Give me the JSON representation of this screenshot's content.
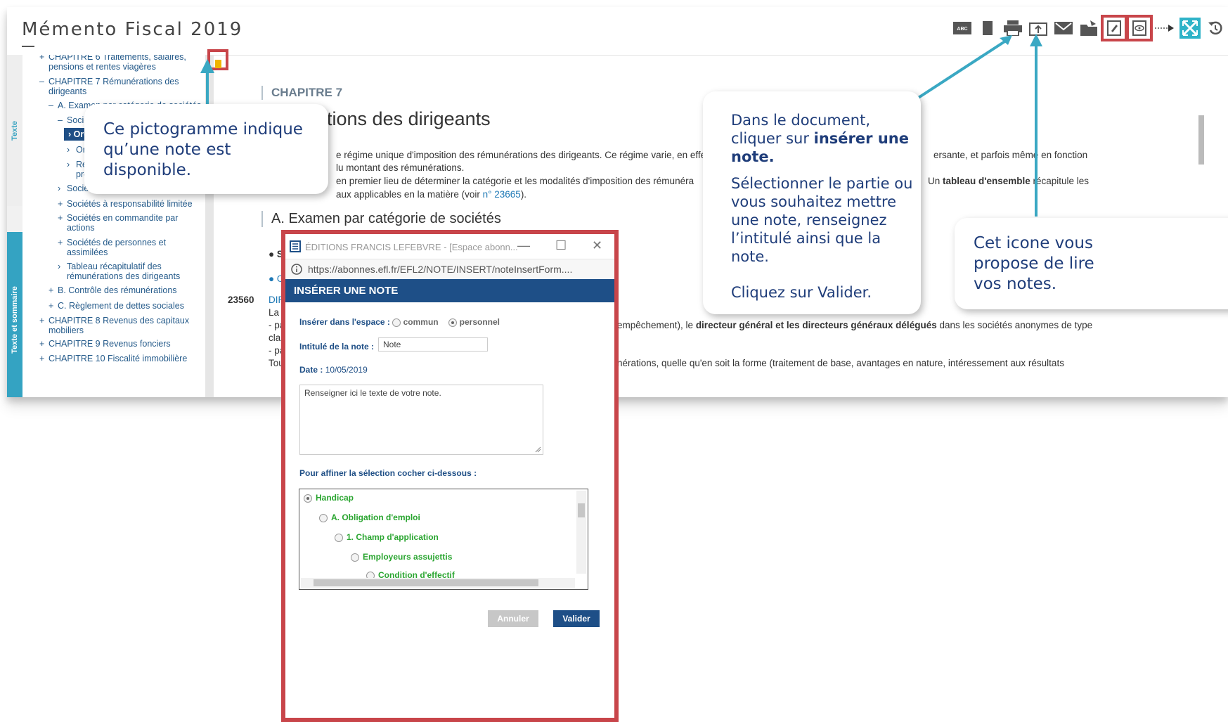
{
  "app": {
    "title": "Mémento Fiscal 2019",
    "toolbar_icons": [
      "abc-icon",
      "bookmark-icon",
      "print-icon",
      "export-icon",
      "mail-icon",
      "folder-icon",
      "insert-note-icon",
      "read-notes-icon",
      "arrow-icon",
      "fullscreen-icon",
      "history-icon"
    ]
  },
  "sidebar": {
    "tab_text": "Texte",
    "tab_summary": "Texte et sommaire",
    "items": [
      {
        "marker": "+",
        "label": "CHAPITRE 6 Traitements, salaires,"
      },
      {
        "marker": "",
        "label": "pensions et rentes viagères"
      },
      {
        "marker": "–",
        "label": "CHAPITRE 7 Rémunérations des"
      },
      {
        "marker": "",
        "label": "dirigeants"
      },
      {
        "marker": "–",
        "label": "A. Examen par catégorie de sociétés"
      },
      {
        "marker": "–",
        "label": "Société"
      },
      {
        "marker": "›",
        "label": "Orga"
      },
      {
        "marker": "›",
        "label": "Orga"
      },
      {
        "marker": "›",
        "label": "Régi"
      },
      {
        "marker": "",
        "label": "prés"
      },
      {
        "marker": "›",
        "label": "Société"
      },
      {
        "marker": "+",
        "label": "Sociétés à responsabilité limitée"
      },
      {
        "marker": "+",
        "label": "Sociétés en commandite par"
      },
      {
        "marker": "",
        "label": "actions"
      },
      {
        "marker": "+",
        "label": "Sociétés de personnes et"
      },
      {
        "marker": "",
        "label": "assimilées"
      },
      {
        "marker": "›",
        "label": "Tableau récapitulatif des"
      },
      {
        "marker": "",
        "label": "rémunérations des dirigeants"
      },
      {
        "marker": "+",
        "label": "B. Contrôle des rémunérations"
      },
      {
        "marker": "+",
        "label": "C. Règlement de dettes sociales"
      },
      {
        "marker": "+",
        "label": "CHAPITRE 8 Revenus des capitaux"
      },
      {
        "marker": "",
        "label": "mobiliers"
      },
      {
        "marker": "+",
        "label": "CHAPITRE 9 Revenus fonciers"
      },
      {
        "marker": "+",
        "label": "CHAPITRE 10 Fiscalité immobilière"
      }
    ]
  },
  "document": {
    "chapter_label": "CHAPITRE 7",
    "chapter_title": "érations des dirigeants",
    "line1a": "e régime unique d'imposition des rémunérations des dirigeants. Ce régime varie, en effe",
    "line1b": "ersante, et parfois même en fonction",
    "line2": "lu montant des rémunérations.",
    "line3a": "en premier lieu de déterminer la catégorie et les modalités d'imposition des rémunéra",
    "line3b_prefix": "Un ",
    "line3b_bold": "tableau d'ensemble",
    "line3b_suffix": " récapitule les",
    "line4": "aux applicables en la matière (voir ",
    "line4_link": "n° 23665",
    "line4_end": ").",
    "section_title": "A.  Examen par catégorie de sociétés",
    "bullet1": "● S",
    "bullet2": "● O",
    "para_num": "23560",
    "para_ref": "DIR-",
    "la": "La d",
    "dash1": "- pa",
    "clas": "clas",
    "dash2": "- pa",
    "tou": "Tou",
    "right_line_a": "empêchement), le ",
    "right_line_b": "directeur général et les directeurs généraux délégués",
    "right_line_c": " dans les sociétés anonymes de type",
    "bottom_line": "nérations, quelle qu'en soit la forme (traitement de base, avantages en nature, intéressement aux résultats"
  },
  "callouts": {
    "pictogram": "Ce pictogramme indique qu’une note est disponible.",
    "insert_l1": "Dans le document,",
    "insert_l2a": "cliquer sur ",
    "insert_l2b": "insérer une",
    "insert_l3": "note.",
    "insert_p2": "Sélectionner le partie ou vous souhaitez mettre une note, renseignez l’intitulé ainsi que la note.",
    "insert_p3": "Cliquez sur Valider.",
    "read": "Cet icone vous propose de lire vos notes."
  },
  "popup": {
    "window_title": "ÉDITIONS FRANCIS LEFEBVRE - [Espace abonn...",
    "url": "https://abonnes.efl.fr/EFL2/NOTE/INSERT/noteInsertForm....",
    "header": "INSÉRER UNE NOTE",
    "space_label": "Insérer dans l'espace :",
    "opt_common": "commun",
    "opt_personal": "personnel",
    "title_label": "Intitulé de la note :",
    "title_value": "Note",
    "date_label": "Date :",
    "date_value": "10/05/2019",
    "text_placeholder": "Renseigner ici le texte de votre note.",
    "refine_label": "Pour affiner la sélection cocher ci-dessous :",
    "tree": [
      "Handicap",
      "A. Obligation d'emploi",
      "1. Champ d'application",
      "Employeurs assujettis",
      "Condition d'effectif"
    ],
    "cancel": "Annuler",
    "validate": "Valider"
  }
}
